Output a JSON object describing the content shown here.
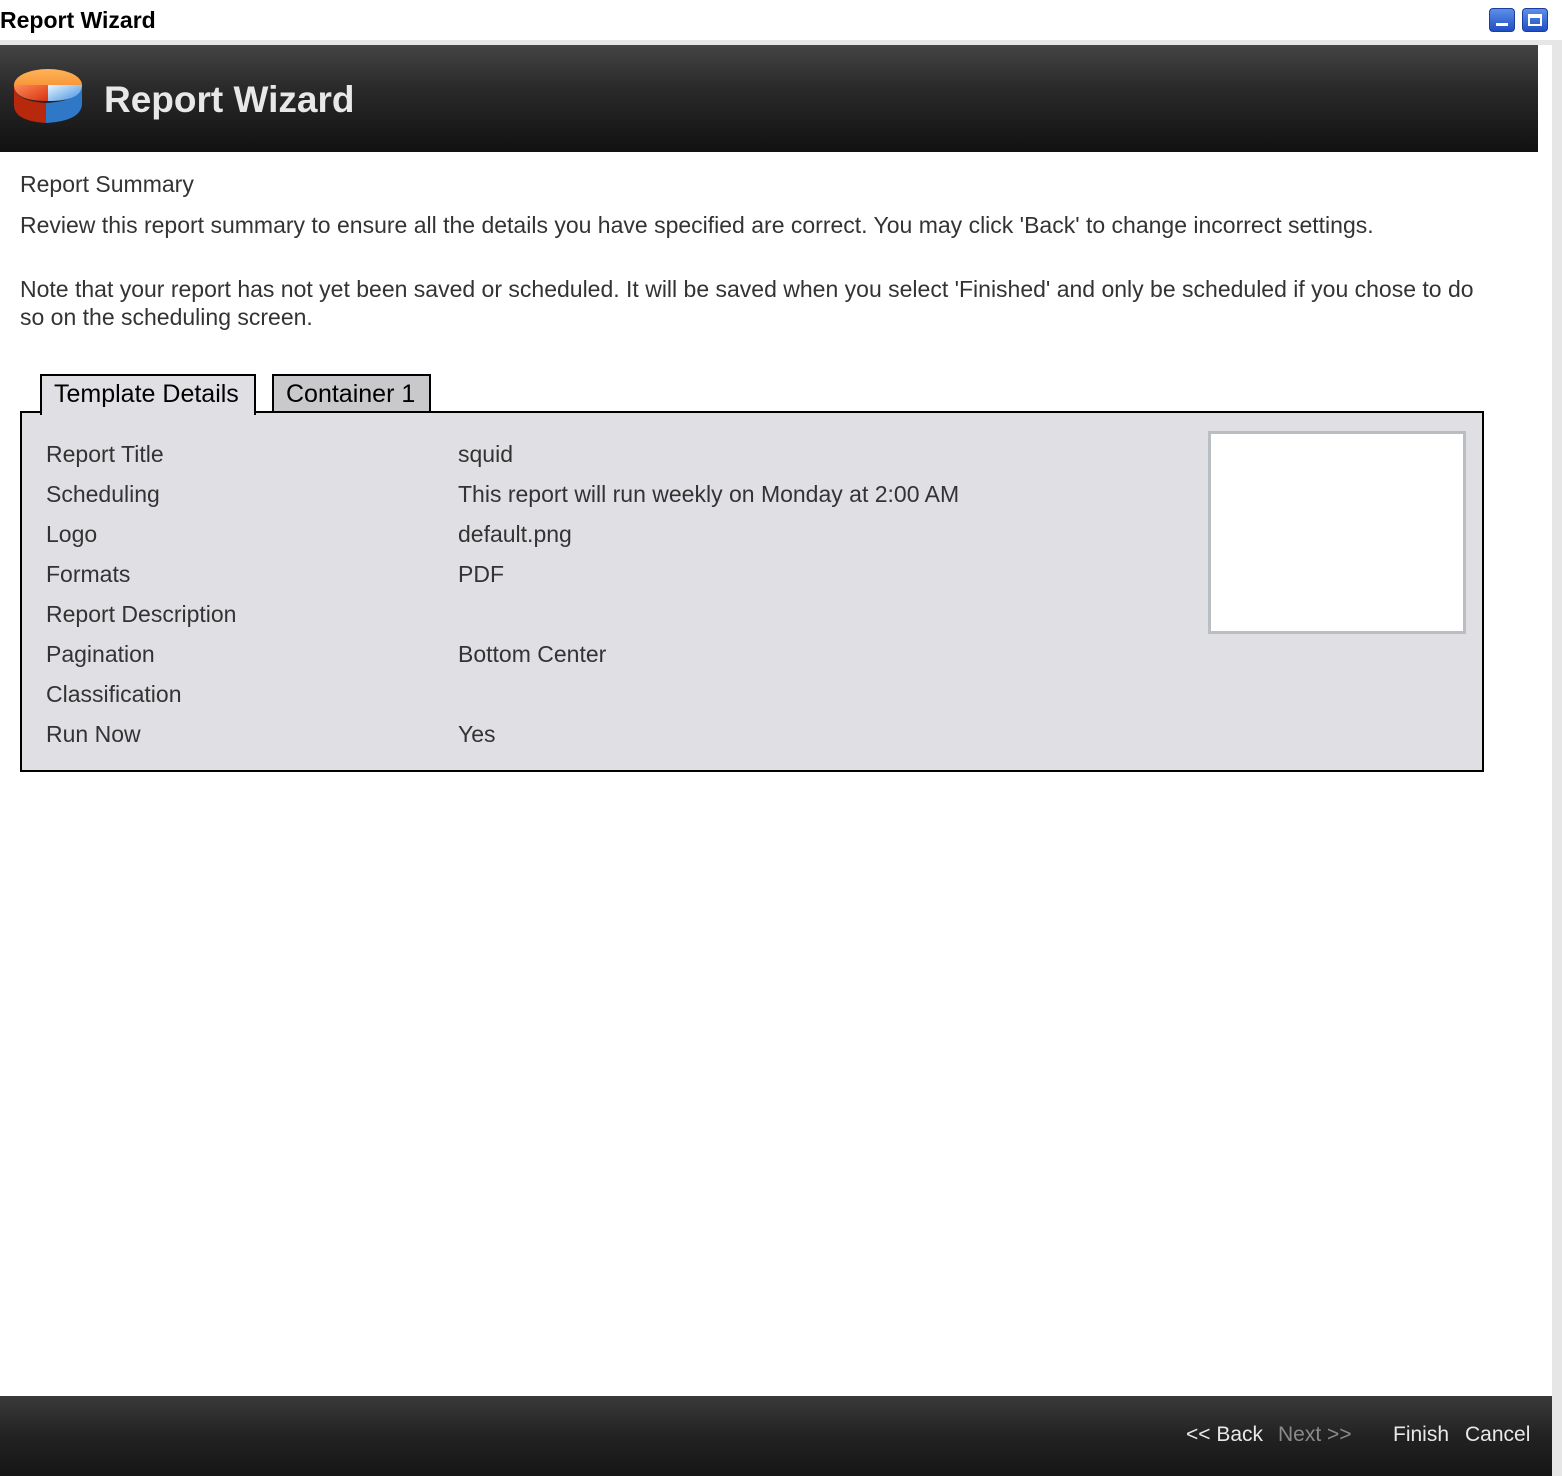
{
  "window": {
    "title": "Report Wizard",
    "controls": [
      "minimize",
      "maximize"
    ]
  },
  "header": {
    "title": "Report Wizard",
    "icon": "pie-chart-icon"
  },
  "summary": {
    "section_title": "Report Summary",
    "intro": "Review this report summary to ensure all the details you have specified are correct. You may click 'Back' to change incorrect settings.",
    "note": "Note that your report has not yet been saved or scheduled. It will be saved when you select 'Finished' and only be scheduled if you chose to do so on the scheduling screen."
  },
  "tabs": [
    {
      "label": "Template Details",
      "active": true
    },
    {
      "label": "Container 1",
      "active": false
    }
  ],
  "details": [
    {
      "label": "Report Title",
      "value": "squid"
    },
    {
      "label": "Scheduling",
      "value": "This report will run weekly on Monday at 2:00 AM"
    },
    {
      "label": "Logo",
      "value": "default.png"
    },
    {
      "label": "Formats",
      "value": "PDF"
    },
    {
      "label": "Report Description",
      "value": ""
    },
    {
      "label": "Pagination",
      "value": "Bottom Center"
    },
    {
      "label": "Classification",
      "value": ""
    },
    {
      "label": "Run Now",
      "value": "Yes"
    }
  ],
  "footer": {
    "back_label": "<< Back",
    "next_label": "Next >>",
    "finish_label": "Finish",
    "cancel_label": "Cancel"
  },
  "colors": {
    "banner": "#1c1c1c",
    "panel_bg": "#e0e0e4",
    "disabled_text": "#8a8a8a"
  }
}
